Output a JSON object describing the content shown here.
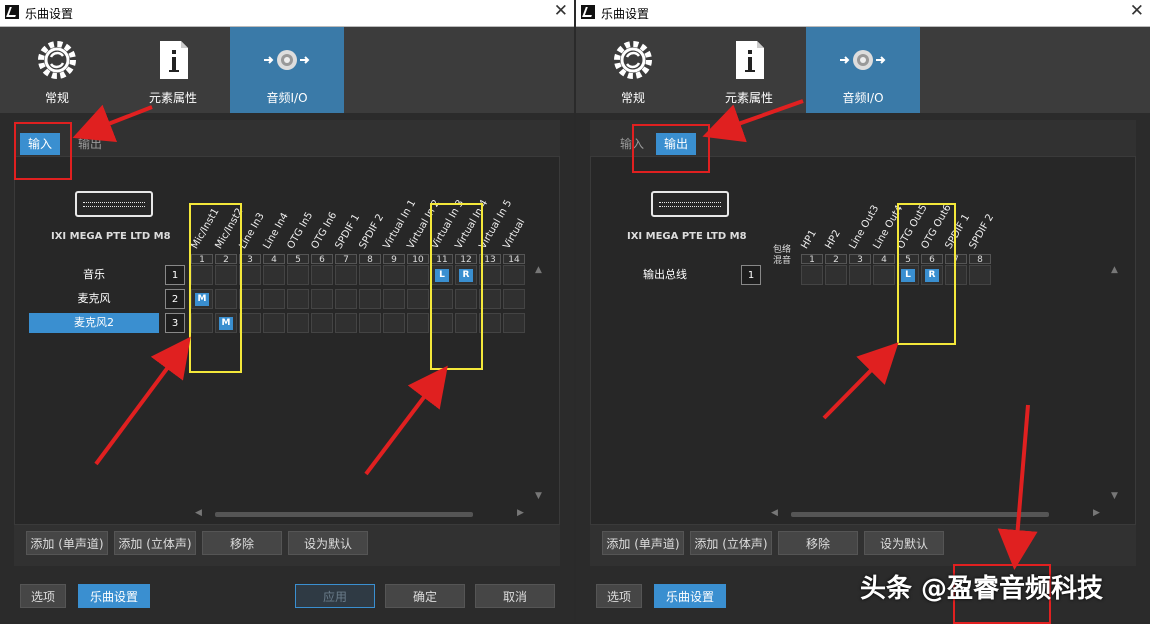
{
  "left": {
    "title": "乐曲设置",
    "tabs": [
      "常规",
      "元素属性",
      "音频I/O"
    ],
    "selected_tab": 2,
    "subtabs": {
      "input": "输入",
      "output": "输出"
    },
    "device_name": "IXI MEGA PTE LTD M8",
    "channels": [
      "Mic/Inst1",
      "Mic/Inst2",
      "Line In3",
      "Line In4",
      "OTG In5",
      "OTG In6",
      "SPDIF 1",
      "SPDIF 2",
      "Virtual In 1",
      "Virtual In 2",
      "Virtual In 3",
      "Virtual In 4",
      "Virtual In 5",
      "Virtual"
    ],
    "channel_numbers": [
      "1",
      "2",
      "3",
      "4",
      "5",
      "6",
      "7",
      "8",
      "9",
      "10",
      "11",
      "12",
      "13",
      "14"
    ],
    "rows": [
      {
        "label": "音乐",
        "num": "1",
        "marks": {
          "10": "L",
          "11": "R"
        }
      },
      {
        "label": "麦克风",
        "num": "2",
        "marks": {
          "0": "M"
        }
      },
      {
        "label": "麦克风2",
        "num": "3",
        "marks": {
          "1": "M"
        }
      }
    ],
    "buttons": {
      "add_mono": "添加 (单声道)",
      "add_stereo": "添加 (立体声)",
      "remove": "移除",
      "set_default": "设为默认"
    },
    "footer": {
      "options": "选项",
      "song_setup": "乐曲设置",
      "apply": "应用",
      "ok": "确定",
      "cancel": "取消"
    }
  },
  "right": {
    "title": "乐曲设置",
    "tabs": [
      "常规",
      "元素属性",
      "音频I/O"
    ],
    "selected_tab": 2,
    "subtabs": {
      "input": "输入",
      "output": "输出"
    },
    "device_name": "IXI MEGA PTE LTD M8",
    "mix_label_1": "包络",
    "mix_label_2": "混音",
    "channels": [
      "HP1",
      "HP2",
      "Line Out3",
      "Line Out4",
      "OTG Out5",
      "OTG Out6",
      "SPDIF 1",
      "SPDIF 2"
    ],
    "channel_numbers": [
      "1",
      "2",
      "3",
      "4",
      "5",
      "6",
      "7",
      "8"
    ],
    "rows": [
      {
        "label": "输出总线",
        "num": "1",
        "marks": {
          "4": "L",
          "5": "R"
        }
      }
    ],
    "buttons": {
      "add_mono": "添加 (单声道)",
      "add_stereo": "添加 (立体声)",
      "remove": "移除",
      "set_default": "设为默认"
    },
    "footer": {
      "options": "选项",
      "song_setup": "乐曲设置"
    }
  },
  "watermark": "头条 @盈睿音频科技",
  "colors": {
    "accent": "#3a8fd0",
    "tab_selected": "#3a7aa8",
    "annotation_red": "#e02020",
    "annotation_yellow": "#f4e83a"
  },
  "icons": {
    "tab_general": "gear-refresh-icon",
    "tab_properties": "info-document-icon",
    "tab_audio": "speaker-io-icon"
  }
}
